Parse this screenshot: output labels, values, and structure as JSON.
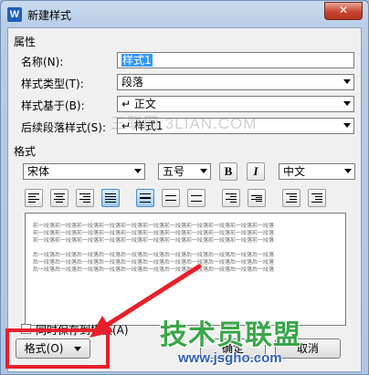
{
  "window": {
    "title": "新建样式",
    "app_icon": "W",
    "close_label": "✕"
  },
  "properties": {
    "section_label": "属性",
    "name_label": "名称(N):",
    "name_value": "样式1",
    "type_label": "样式类型(T):",
    "type_value": "段落",
    "based_on_label": "样式基于(B):",
    "based_on_value": "↵ 正文",
    "next_label": "后续段落样式(S):",
    "next_value": "↵ 样式1"
  },
  "format": {
    "section_label": "格式",
    "font": "宋体",
    "size": "五号",
    "bold_label": "B",
    "italic_label": "I",
    "language": "中文"
  },
  "preview": {
    "line_text": "前一段落前一段落前一段落前一段落前一段落前一段落前一段落前一段落前一段落前一段落前一段落",
    "sample_text": "后一段落后一段落后一段落后一段落后一段落后一段落后一段落后一段落后一段落后一段落后一段落"
  },
  "watermark": "三联网 3LIAN.COM",
  "footer": {
    "add_to_template_label": "同时保存到模板(A)",
    "format_button_label": "格式(O)",
    "ok_label": "确定",
    "cancel_label": "取消"
  },
  "brand": {
    "name": "技术员联盟",
    "url": "www.jsgho.com"
  },
  "colors": {
    "highlight": "#e8202a",
    "brand_green": "#3aa64a",
    "brand_blue": "#2f5fb0"
  }
}
